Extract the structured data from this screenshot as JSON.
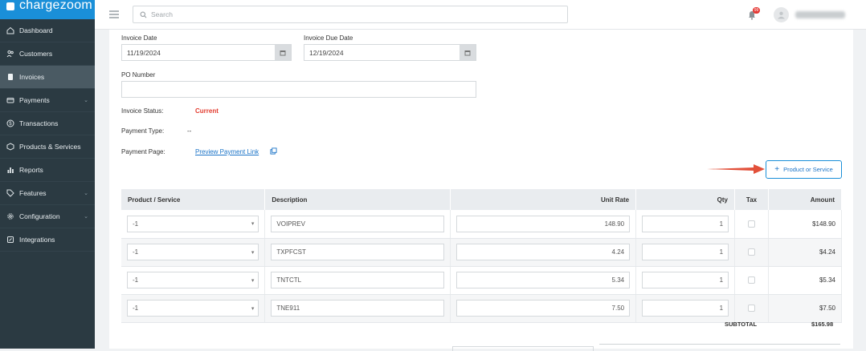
{
  "brand": {
    "name": "chargezoom"
  },
  "sidebar": {
    "items": [
      {
        "label": "Dashboard",
        "icon": "home-icon",
        "caret": false
      },
      {
        "label": "Customers",
        "icon": "users-icon",
        "caret": false
      },
      {
        "label": "Invoices",
        "icon": "invoice-icon",
        "caret": false,
        "active": true
      },
      {
        "label": "Payments",
        "icon": "card-icon",
        "caret": true
      },
      {
        "label": "Transactions",
        "icon": "dollar-icon",
        "caret": false
      },
      {
        "label": "Products & Services",
        "icon": "box-icon",
        "caret": false
      },
      {
        "label": "Reports",
        "icon": "chart-icon",
        "caret": false
      },
      {
        "label": "Features",
        "icon": "tag-icon",
        "caret": true
      },
      {
        "label": "Configuration",
        "icon": "gear-icon",
        "caret": true
      },
      {
        "label": "Integrations",
        "icon": "plug-icon",
        "caret": false
      }
    ]
  },
  "topbar": {
    "search_placeholder": "Search",
    "notification_count": "99"
  },
  "form": {
    "invoice_date_label": "Invoice Date",
    "invoice_date_value": "11/19/2024",
    "due_date_label": "Invoice Due Date",
    "due_date_value": "12/19/2024",
    "po_label": "PO Number",
    "po_value": "",
    "status_label": "Invoice Status:",
    "status_value": "Current",
    "payment_type_label": "Payment Type:",
    "payment_type_value": "--",
    "payment_page_label": "Payment Page:",
    "payment_page_link": "Preview Payment Link"
  },
  "add_button": {
    "label": "Product or Service"
  },
  "table": {
    "headers": [
      "Product / Service",
      "Description",
      "Unit Rate",
      "Qty",
      "Tax",
      "Amount"
    ],
    "rows": [
      {
        "product": "-1",
        "description": "VOIPREV",
        "rate": "148.90",
        "qty": "1",
        "amount": "$148.90"
      },
      {
        "product": "-1",
        "description": "TXPFCST",
        "rate": "4.24",
        "qty": "1",
        "amount": "$4.24"
      },
      {
        "product": "-1",
        "description": "TNTCTL",
        "rate": "5.34",
        "qty": "1",
        "amount": "$5.34"
      },
      {
        "product": "-1",
        "description": "TNE911",
        "rate": "7.50",
        "qty": "1",
        "amount": "$7.50"
      }
    ]
  },
  "totals": {
    "subtotal_label": "SUBTOTAL",
    "subtotal_value": "$165.98"
  },
  "colors": {
    "sidebar_bg": "#2b3a42",
    "brand_bg": "#1a8fd8",
    "status_red": "#e23b2e",
    "arrow": "#e2503a"
  }
}
